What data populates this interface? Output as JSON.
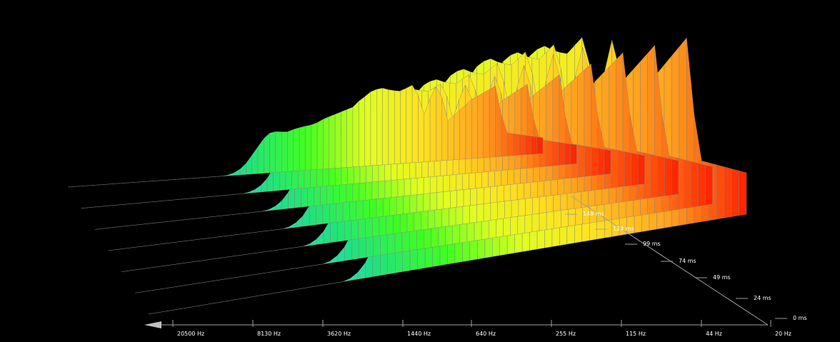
{
  "chart_data": {
    "type": "waterfall-3d",
    "title": "",
    "background": "#000000",
    "grid_line_color": "#808080",
    "x_axis": {
      "ticks": [
        "20500 Hz",
        "8130 Hz",
        "3620 Hz",
        "1440 Hz",
        "640 Hz",
        "255 Hz",
        "115 Hz",
        "44 Hz",
        "20 Hz"
      ]
    },
    "z_axis": {
      "ticks": [
        "0 ms",
        "24 ms",
        "49 ms",
        "74 ms",
        "99 ms",
        "124 ms",
        "149 ms"
      ]
    },
    "color_scale": [
      "#e040e0",
      "#2040ff",
      "#30e0ff",
      "#20e080",
      "#40ff20",
      "#e0ff20",
      "#ffe020",
      "#ffa020",
      "#ff2000"
    ],
    "slices_description": "spectral slices decaying from 0 ms to 149 ms",
    "profile_x": [
      0,
      0.33,
      0.345,
      0.36,
      0.375,
      0.39,
      0.41,
      0.42,
      0.44,
      0.46,
      0.48,
      0.52,
      0.54,
      0.56,
      0.58,
      0.6,
      0.61,
      0.62,
      0.64,
      0.66,
      0.68,
      0.7,
      0.73,
      0.75,
      0.77,
      0.78,
      0.8,
      0.85,
      0.9,
      0.92,
      1.0
    ],
    "profile_y": [
      0,
      0,
      0.02,
      0.06,
      0.14,
      0.26,
      0.42,
      0.5,
      0.52,
      0.5,
      0.54,
      0.58,
      0.64,
      0.68,
      0.72,
      0.76,
      0.82,
      0.86,
      0.95,
      0.98,
      0.94,
      0.92,
      1.0,
      0.6,
      0.92,
      0.98,
      0.5,
      0.75,
      0.9,
      0.3,
      0.2
    ],
    "slice_scale": [
      0.38,
      0.45,
      0.56,
      0.68,
      0.8,
      0.9,
      1.0
    ]
  }
}
